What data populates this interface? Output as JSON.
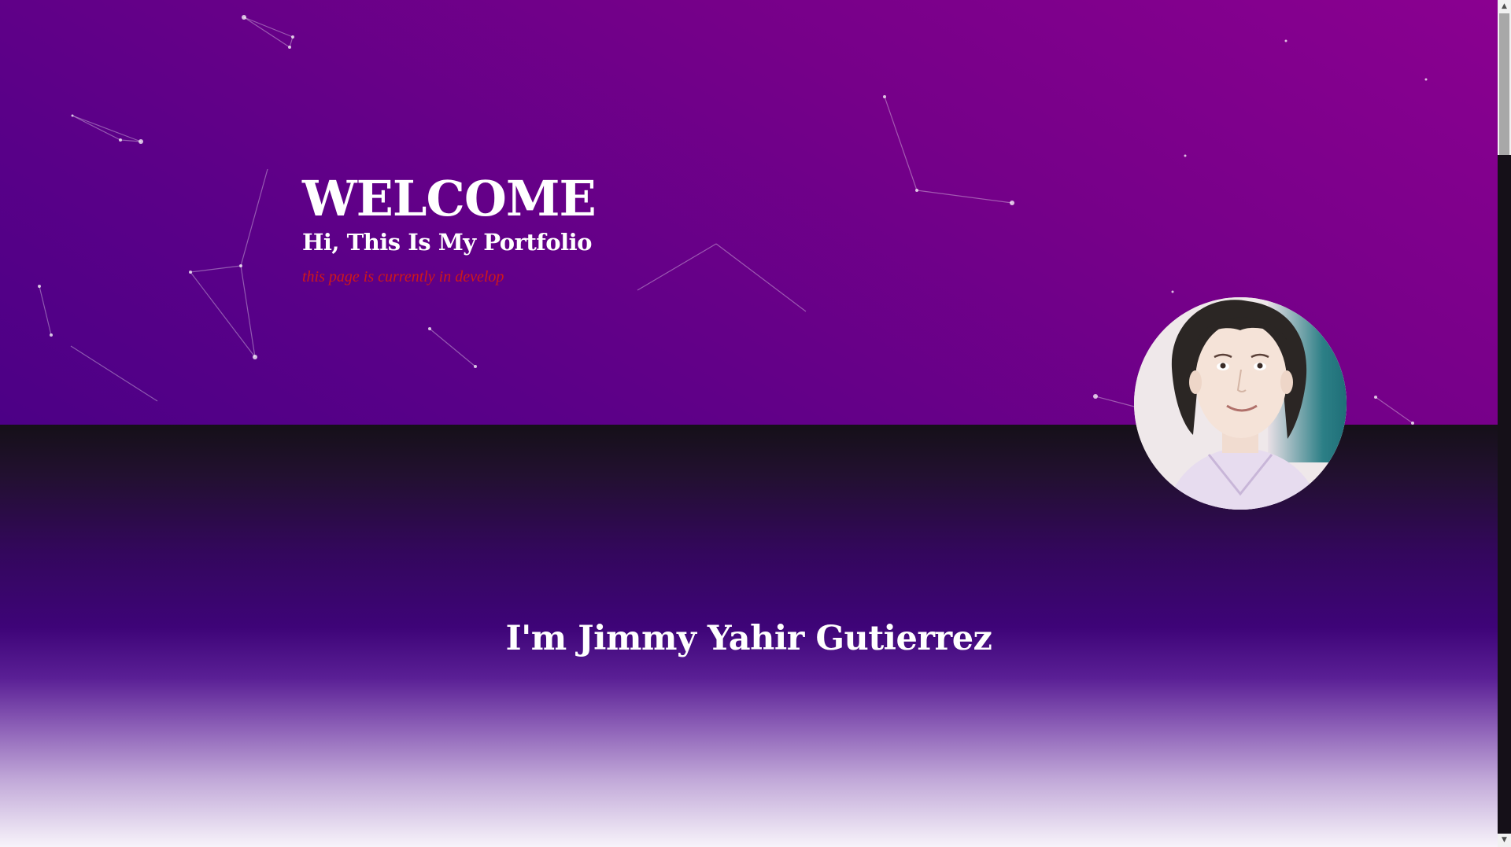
{
  "hero": {
    "title": "WELCOME",
    "subtitle": "Hi, This Is My Portfolio",
    "note": "this page is currently in develop",
    "note_color": "#d01818",
    "background_colors": [
      "#8a0090",
      "#5a0088"
    ]
  },
  "about": {
    "name": "I'm Jimmy Yahir Gutierrez"
  },
  "profile_photo": {
    "shape": "circle",
    "icon": "avatar-photo"
  },
  "scrollbar": {
    "up_arrow": "▲",
    "down_arrow": "▼"
  }
}
